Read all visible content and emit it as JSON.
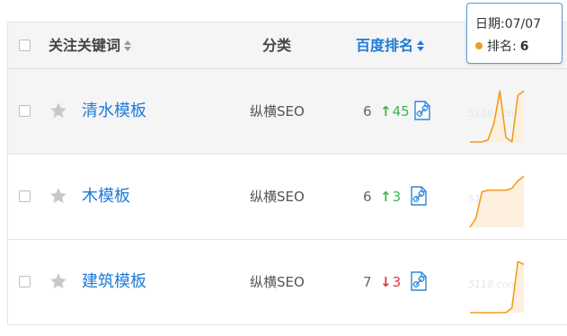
{
  "header": {
    "keyword_label": "关注关键词",
    "category_label": "分类",
    "rank_label": "百度排名"
  },
  "rows": [
    {
      "keyword": "清水模板",
      "category": "纵横SEO",
      "rank": "6",
      "change_symbol": "↑",
      "change": "45",
      "change_dir": "up",
      "trend": [
        60,
        60,
        60,
        58,
        40,
        5,
        55,
        60,
        10,
        5
      ]
    },
    {
      "keyword": "木模板",
      "category": "纵横SEO",
      "rank": "6",
      "change_symbol": "↑",
      "change": "3",
      "change_dir": "up",
      "trend": [
        60,
        50,
        22,
        20,
        20,
        20,
        20,
        18,
        10,
        5
      ]
    },
    {
      "keyword": "建筑模板",
      "category": "纵横SEO",
      "rank": "7",
      "change_symbol": "↓",
      "change": "3",
      "change_dir": "down",
      "trend": [
        60,
        60,
        60,
        60,
        60,
        60,
        60,
        55,
        5,
        8
      ]
    }
  ],
  "tooltip": {
    "date_text": "日期:07/07",
    "rank_label": "排名:",
    "rank_value": "6"
  },
  "watermark": "5118.com",
  "colors": {
    "link": "#1e7ad8",
    "up": "#3fb34f",
    "down": "#e03b3b",
    "trend_line": "#f29c1f",
    "trend_fill": "#fdeedb",
    "tooltip_border": "#5b9bd5"
  },
  "icons": {
    "sort": "sort-arrows-icon",
    "star": "star-icon",
    "snapshot": "snapshot-link-icon"
  }
}
